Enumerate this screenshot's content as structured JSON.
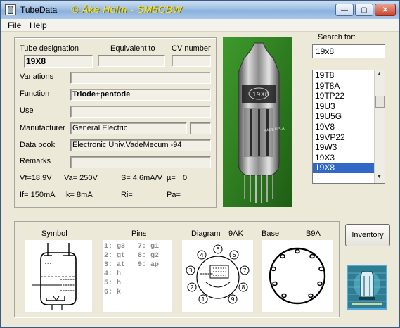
{
  "window": {
    "title": "TubeData",
    "credit": "© Åke Holm - SM5CBW",
    "controls": {
      "minimize": "—",
      "maximize": "▢",
      "close": "✕"
    }
  },
  "menu": {
    "file": "File",
    "help": "Help"
  },
  "details": {
    "designation_label": "Tube designation",
    "designation": "19X8",
    "equivalent_label": "Equivalent to",
    "equivalent": "",
    "cv_label": "CV number",
    "cv": "",
    "variations_label": "Variations",
    "variations": "",
    "function_label": "Function",
    "function": "Triode+pentode",
    "use_label": "Use",
    "use": "",
    "manufacturer_label": "Manufacturer",
    "manufacturer": "General Electric",
    "manufacturer_extra": "",
    "databook_label": "Data book",
    "databook": "Electronic Univ.VadeMecum -94",
    "remarks_label": "Remarks",
    "remarks": ""
  },
  "specs": {
    "vf": "Vf=18,9V",
    "va": "Va= 250V",
    "s": "S= 4,6mA/V",
    "mu": "µ=",
    "mu_val": "0",
    "if": "If= 150mA",
    "ik": "Ik= 8mA",
    "ri": "Ri=",
    "pa": "Pa="
  },
  "photo": {
    "label": "19X8",
    "text": "MADE U.S.A"
  },
  "search": {
    "label": "Search for:",
    "value": "19x8",
    "results": [
      "19T8",
      "19T8A",
      "19TP22",
      "19U3",
      "19U5G",
      "19V8",
      "19VP22",
      "19W3",
      "19X3",
      "19X8"
    ],
    "selected": "19X8"
  },
  "bottom": {
    "symbol_label": "Symbol",
    "pins_label": "Pins",
    "pins_left": [
      "1: g3",
      "2: gt",
      "3: at",
      "4: h",
      "5: h",
      "6: k"
    ],
    "pins_right": [
      "7: g1",
      "8: g2",
      "9: ap"
    ],
    "diagram_label": "Diagram",
    "diagram_code": "9AK",
    "diagram_pins": [
      "1",
      "2",
      "3",
      "4",
      "5",
      "6",
      "7",
      "8",
      "9"
    ],
    "base_label": "Base",
    "base_code": "B9A"
  },
  "inventory_label": "Inventory"
}
